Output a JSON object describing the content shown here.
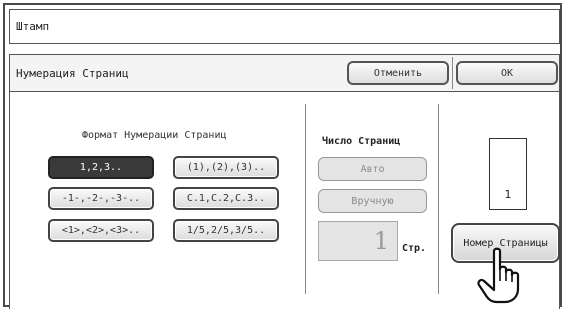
{
  "window": {
    "title": "Штамп"
  },
  "header": {
    "subtitle": "Нумерация Страниц",
    "cancel_label": "Отменить",
    "ok_label": "OK"
  },
  "format": {
    "label": "Формат Нумерации Страниц",
    "options": [
      {
        "label": "1,2,3..",
        "selected": true
      },
      {
        "label": "(1),(2),(3)..",
        "selected": false
      },
      {
        "label": "-1-,-2-,-3-..",
        "selected": false
      },
      {
        "label": "C.1,C.2,C.3..",
        "selected": false
      },
      {
        "label": "<1>,<2>,<3>..",
        "selected": false
      },
      {
        "label": "1/5,2/5,3/5..",
        "selected": false
      }
    ]
  },
  "page_count": {
    "label": "Число Страниц",
    "auto_label": "Авто",
    "manual_label": "Вручную",
    "value": "1",
    "unit": "Стр."
  },
  "preview": {
    "page_number": "1",
    "button_label": "Номер Страницы",
    "pointer_icon": "hand-pointer-icon"
  },
  "colors": {
    "selected_button": "#3a3a3a",
    "disabled_button": "#e4e4e4",
    "border": "#4a4a4a"
  }
}
